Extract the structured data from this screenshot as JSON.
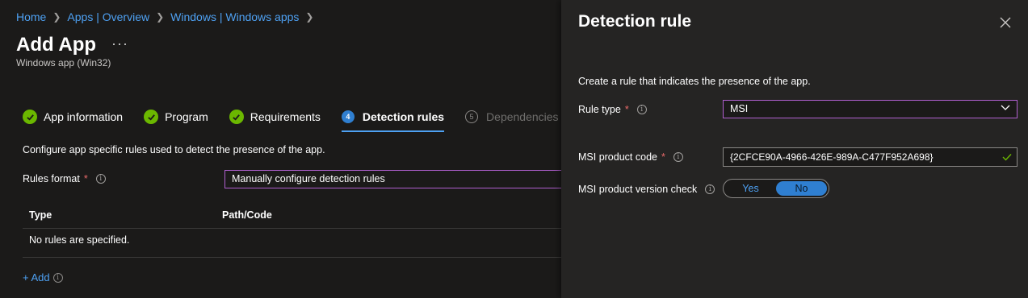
{
  "breadcrumb": [
    "Home",
    "Apps | Overview",
    "Windows | Windows apps"
  ],
  "page": {
    "title": "Add App",
    "more_label": "···",
    "subtitle": "Windows app (Win32)"
  },
  "steps": [
    {
      "label": "App information",
      "state": "done"
    },
    {
      "label": "Program",
      "state": "done"
    },
    {
      "label": "Requirements",
      "state": "done"
    },
    {
      "number": "4",
      "label": "Detection rules",
      "state": "active"
    },
    {
      "number": "5",
      "label": "Dependencies",
      "state": "disabled"
    }
  ],
  "main": {
    "description": "Configure app specific rules used to detect the presence of the app.",
    "rules_format_label": "Rules format",
    "required_mark": "*",
    "info_glyph": "i",
    "rules_format_value": "Manually configure detection rules",
    "table": {
      "headers": [
        "Type",
        "Path/Code"
      ],
      "empty_text": "No rules are specified."
    },
    "add_label": "+ Add"
  },
  "panel": {
    "title": "Detection rule",
    "close_icon": "close-icon",
    "description": "Create a rule that indicates the presence of the app.",
    "rule_type_label": "Rule type",
    "rule_type_value": "MSI",
    "product_code_label": "MSI product code",
    "product_code_value": "{2CFCE90A-4966-426E-989A-C477F952A698}",
    "version_check_label": "MSI product version check",
    "toggle": {
      "yes": "Yes",
      "no": "No",
      "selected": "No"
    }
  },
  "colors": {
    "accent": "#4ea1f3",
    "success": "#6bb700",
    "focus_border": "#b05fcf",
    "required": "#e96a6a"
  }
}
